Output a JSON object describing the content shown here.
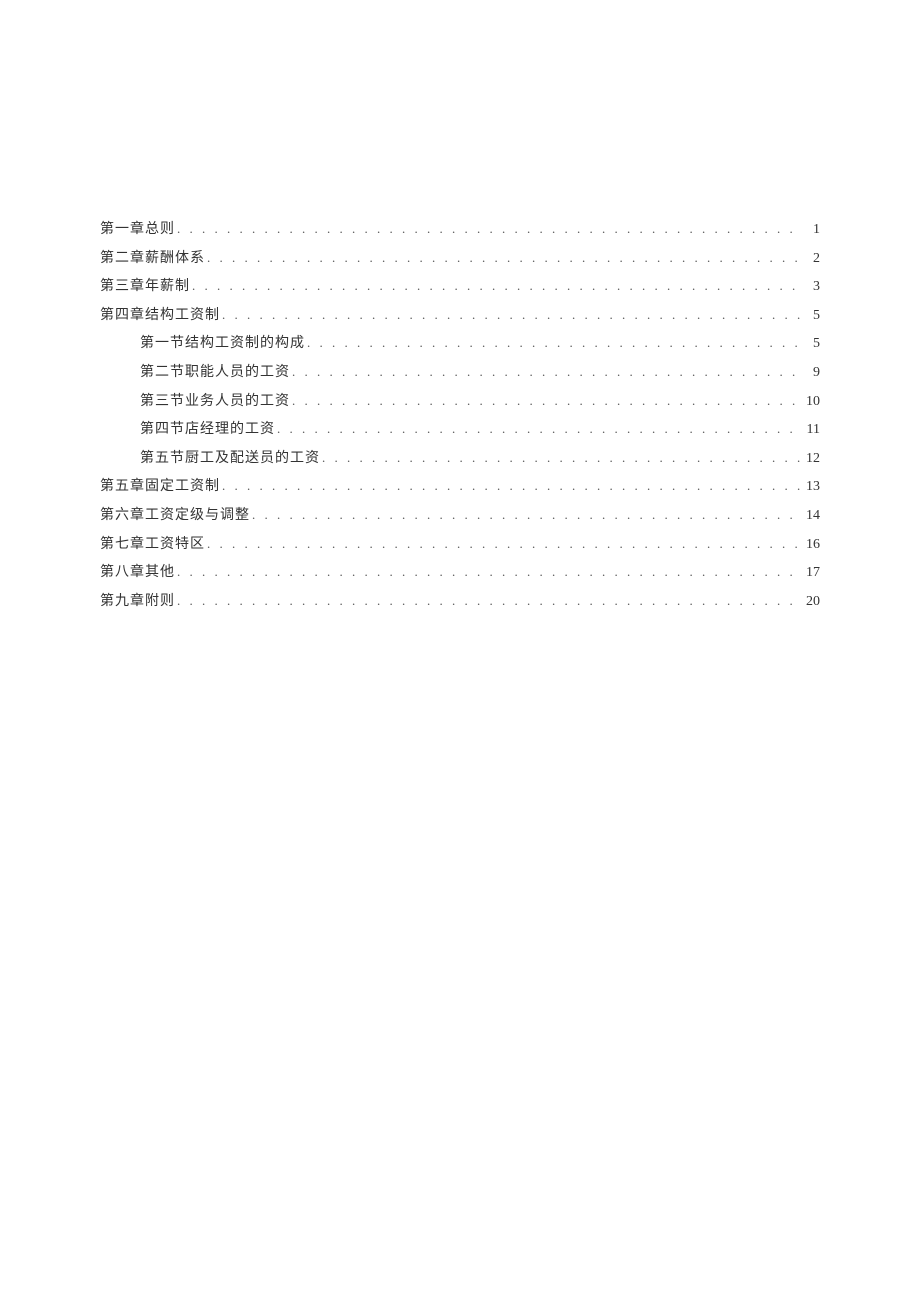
{
  "toc": [
    {
      "level": 1,
      "title": "第一章总则",
      "page": "1"
    },
    {
      "level": 1,
      "title": "第二章薪酬体系",
      "page": "2"
    },
    {
      "level": 1,
      "title": "第三章年薪制",
      "page": "3"
    },
    {
      "level": 1,
      "title": "第四章结构工资制",
      "page": "5"
    },
    {
      "level": 2,
      "title": "第一节结构工资制的构成",
      "page": "5"
    },
    {
      "level": 2,
      "title": "第二节职能人员的工资",
      "page": "9"
    },
    {
      "level": 2,
      "title": "第三节业务人员的工资",
      "page": "10"
    },
    {
      "level": 2,
      "title": "第四节店经理的工资",
      "page": "11"
    },
    {
      "level": 2,
      "title": "第五节厨工及配送员的工资",
      "page": "12"
    },
    {
      "level": 1,
      "title": "第五章固定工资制",
      "page": "13"
    },
    {
      "level": 1,
      "title": "第六章工资定级与调整",
      "page": "14"
    },
    {
      "level": 1,
      "title": "第七章工资特区",
      "page": "16"
    },
    {
      "level": 1,
      "title": "第八章其他",
      "page": "17"
    },
    {
      "level": 1,
      "title": "第九章附则",
      "page": "20"
    }
  ],
  "leader": ". . . . . . . . . . . . . . . . . . . . . . . . . . . . . . . . . . . . . . . . . . . . . . . . . . . . . . . . . . . . . . . . . . . . . . . . . . . . . . . . . . . . . . . . . . . . . . . . . . . . . . . . . . . . . . . . . ."
}
